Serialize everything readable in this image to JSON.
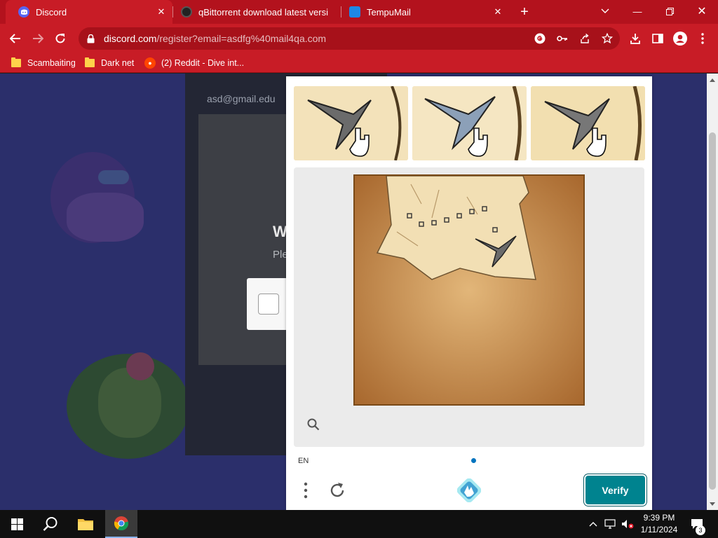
{
  "tabs": [
    {
      "title": "Discord",
      "favicon": "discord-icon",
      "active": true
    },
    {
      "title": "qBittorrent download latest versi",
      "favicon": "qbittorrent-icon",
      "active": false
    },
    {
      "title": "TempuMail",
      "favicon": "tempumail-icon",
      "active": false
    }
  ],
  "address_bar": {
    "url_host": "discord.com",
    "url_path": "/register?email=asdfg%40mail4qa.com"
  },
  "bookmarks": [
    {
      "label": "Scambaiting"
    },
    {
      "label": "Dark net"
    },
    {
      "label": "(2) Reddit - Dive int..."
    }
  ],
  "background_page": {
    "email_value": "asd@gmail.edu",
    "heading": "W",
    "subtext": "Ple"
  },
  "captcha": {
    "language": "EN",
    "verify_label": "Verify"
  },
  "taskbar": {
    "time": "9:39 PM",
    "date": "1/11/2024",
    "notification_count": "3"
  },
  "colors": {
    "chrome_tab_strip": "#b3121d",
    "chrome_toolbar": "#c81c26",
    "verify_button": "#00838f",
    "page_background": "#2b2f6b"
  }
}
